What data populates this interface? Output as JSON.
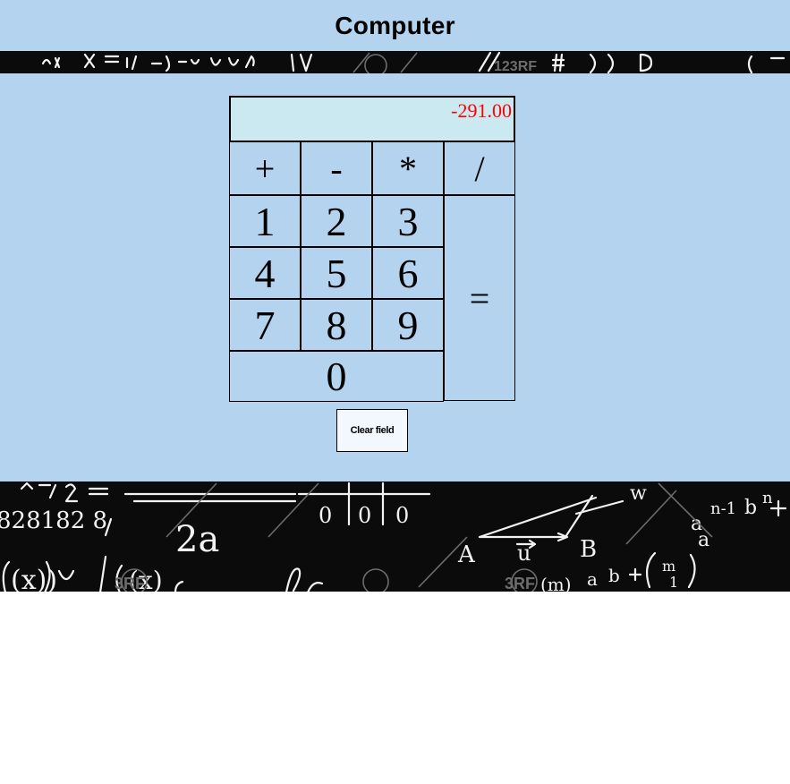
{
  "page": {
    "title": "Computer"
  },
  "calculator": {
    "display_value": "-291.00",
    "display_color": "#ff0000",
    "operators": {
      "add": "+",
      "subtract": "-",
      "multiply": "*",
      "divide": "/"
    },
    "digits": {
      "d0": "0",
      "d1": "1",
      "d2": "2",
      "d3": "3",
      "d4": "4",
      "d5": "5",
      "d6": "6",
      "d7": "7",
      "d8": "8",
      "d9": "9"
    },
    "equals": "=",
    "clear_label": "Clear field"
  },
  "colors": {
    "panel_background": "#b4d3ee",
    "display_background": "#cbe9f0",
    "chalkboard": "#0b0b0b"
  }
}
